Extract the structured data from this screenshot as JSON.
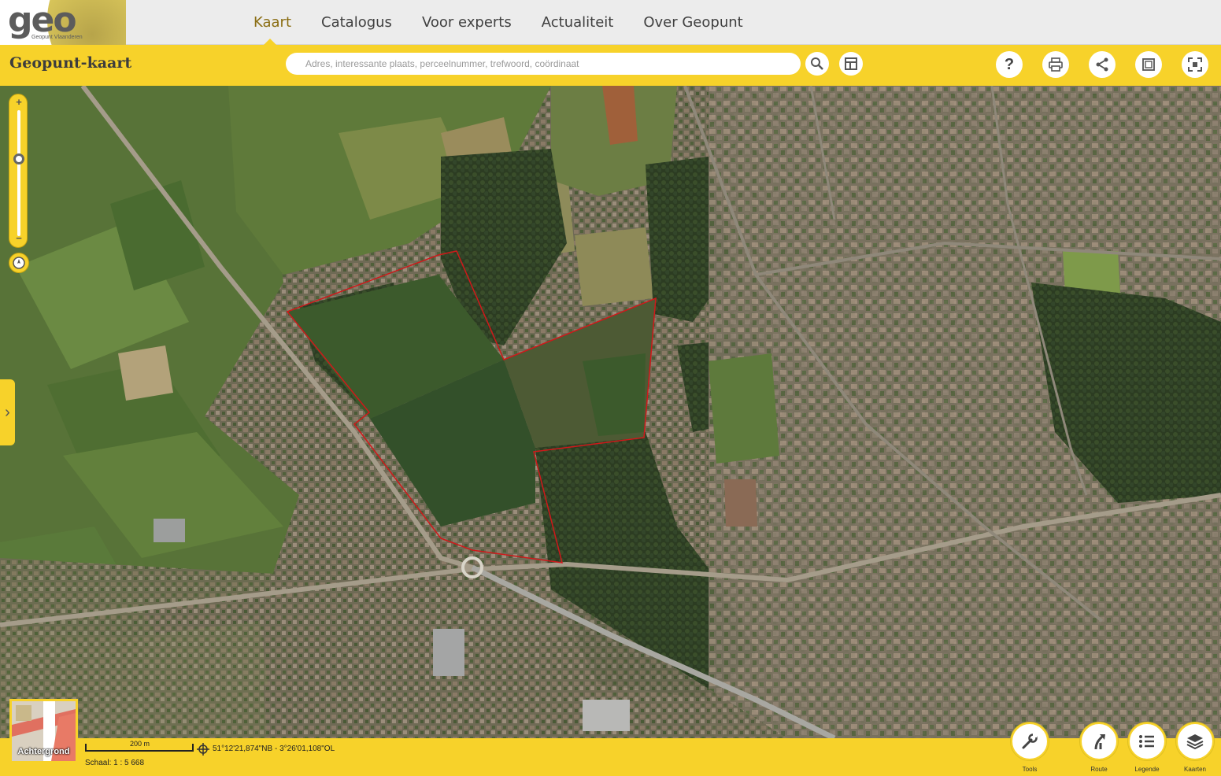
{
  "logo": {
    "text": "geo",
    "subtitle": "Geopunt Vlaanderen"
  },
  "nav": {
    "items": [
      {
        "label": "Kaart",
        "active": true
      },
      {
        "label": "Catalogus",
        "active": false
      },
      {
        "label": "Voor experts",
        "active": false
      },
      {
        "label": "Actualiteit",
        "active": false
      },
      {
        "label": "Over Geopunt",
        "active": false
      }
    ]
  },
  "toolbar": {
    "title": "Geopunt-kaart",
    "search_placeholder": "Adres, interessante plaats, perceelnummer, trefwoord, coördinaat",
    "buttons": [
      {
        "icon": "search-icon"
      },
      {
        "icon": "table-icon"
      },
      {
        "icon": "help-icon",
        "label": "?"
      },
      {
        "icon": "print-icon"
      },
      {
        "icon": "share-icon"
      },
      {
        "icon": "window-icon"
      },
      {
        "icon": "fullscreen-icon"
      }
    ]
  },
  "map": {
    "zoom_plus": "+",
    "zoom_minus": "−",
    "panel_toggle": "›"
  },
  "bottom": {
    "background_label": "Achtergrond",
    "scalebar_label": "200 m",
    "scale_text": "Schaal: 1 : 5 668",
    "coordinates": "51°12'21,874\"NB - 3°26'01,108\"OL",
    "fabs": [
      {
        "icon": "wrench-icon",
        "label": "Tools"
      },
      {
        "icon": "route-icon",
        "label": "Route"
      },
      {
        "icon": "list-icon",
        "label": "Legende"
      },
      {
        "icon": "layers-icon",
        "label": "Kaarten"
      }
    ]
  },
  "colors": {
    "brand_yellow": "#f7d22a",
    "nav_active": "#8a6d12",
    "parcel_outline": "#d0181a"
  }
}
